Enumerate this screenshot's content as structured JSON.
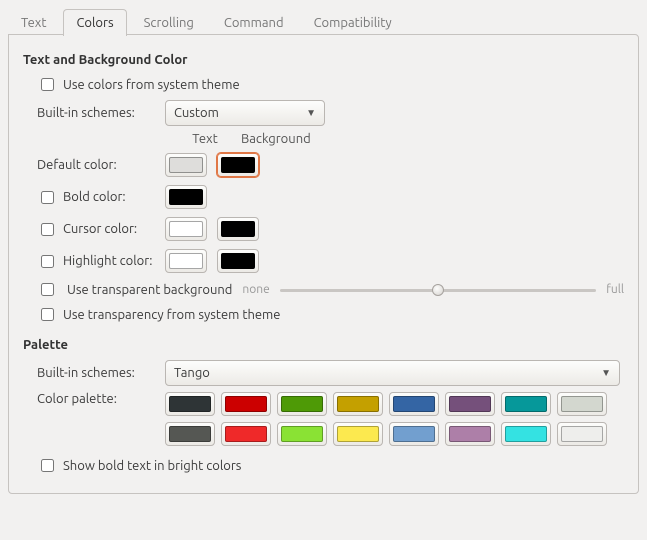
{
  "tabs": {
    "text": "Text",
    "colors": "Colors",
    "scrolling": "Scrolling",
    "command": "Command",
    "compatibility": "Compatibility"
  },
  "section1": {
    "title": "Text and Background Color",
    "use_system": "Use colors from system theme",
    "schemes_label": "Built-in schemes:",
    "schemes_value": "Custom",
    "header_text": "Text",
    "header_bg": "Background",
    "default_label": "Default color:",
    "default_text_color": "#dedddb",
    "default_bg_color": "#000000",
    "bold_label": "Bold color:",
    "bold_color": "#000000",
    "cursor_label": "Cursor color:",
    "cursor_text_color": "#ffffff",
    "cursor_bg_color": "#000000",
    "highlight_label": "Highlight color:",
    "highlight_text_color": "#ffffff",
    "highlight_bg_color": "#000000",
    "transparent_bg": "Use transparent background",
    "slider_none": "none",
    "slider_full": "full",
    "transparency_system": "Use transparency from system theme"
  },
  "section2": {
    "title": "Palette",
    "schemes_label": "Built-in schemes:",
    "schemes_value": "Tango",
    "palette_label": "Color palette:",
    "palette": [
      "#2e3436",
      "#cc0000",
      "#4e9a06",
      "#c4a000",
      "#3465a4",
      "#75507b",
      "#06989a",
      "#d3d7cf",
      "#555753",
      "#ef2929",
      "#8ae234",
      "#fce94f",
      "#729fcf",
      "#ad7fa8",
      "#34e2e2",
      "#eeeeec"
    ],
    "show_bold_bright": "Show bold text in bright colors"
  }
}
